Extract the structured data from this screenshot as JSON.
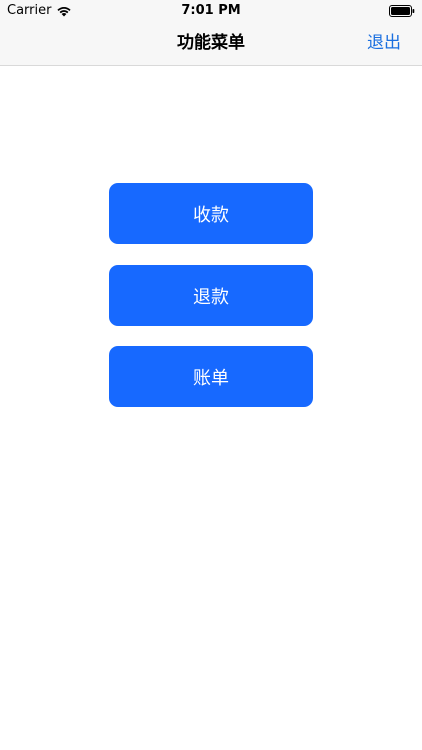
{
  "status_bar": {
    "carrier": "Carrier",
    "time": "7:01 PM",
    "wifi_icon": "wifi-icon",
    "battery_icon": "battery-full-icon"
  },
  "nav": {
    "title": "功能菜单",
    "right_action": "退出"
  },
  "menu": {
    "collect_label": "收款",
    "refund_label": "退款",
    "bill_label": "账单"
  },
  "colors": {
    "accent": "#1769ff",
    "nav_action": "#1a6fe0",
    "nav_background": "#f7f7f7"
  }
}
